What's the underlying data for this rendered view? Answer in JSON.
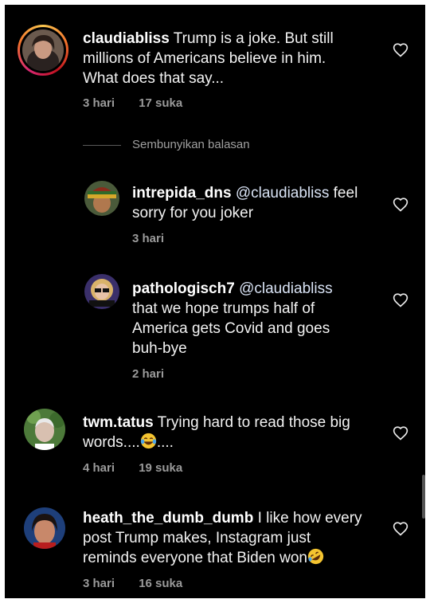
{
  "comments": [
    {
      "username": "claudiabliss",
      "text": "Trump is a joke. But still millions of Americans believe in him. What does that say...",
      "line1": "Trump is a joke. But still",
      "line2": "millions of Americans believe in him.",
      "line3": "What does that say...",
      "time": "3 hari",
      "likes": "17 suka"
    },
    {
      "username": "twm.tatus",
      "line1": "Trying hard to read those big",
      "line2": "words....",
      "line2_suffix": "....",
      "time": "4 hari",
      "likes": "19 suka"
    },
    {
      "username": "heath_the_dumb_dumb",
      "line1": "I like how every",
      "line2": "post Trump makes, Instagram just",
      "line3": "reminds everyone that Biden won",
      "time": "3 hari",
      "likes": "16 suka"
    }
  ],
  "replies_toggle": "Sembunyikan balasan",
  "replies": [
    {
      "username": "intrepida_dns",
      "mention": "@claudiabliss",
      "line1_rest": " feel",
      "line2": "sorry for you joker",
      "time": "3 hari"
    },
    {
      "username": "pathologisch7",
      "mention": "@claudiabliss",
      "line2": "that we hope trumps half of",
      "line3": "America gets Covid and goes",
      "line4": "buh-bye",
      "time": "2 hari"
    }
  ],
  "icons": {
    "like": "heart-outline-icon",
    "laugh_emoji": "face-with-tears-of-joy",
    "rofl_emoji": "rolling-on-floor-laughing"
  },
  "colors": {
    "background": "#000000",
    "text": "#f2f2f2",
    "secondary": "#9a9a9a"
  }
}
